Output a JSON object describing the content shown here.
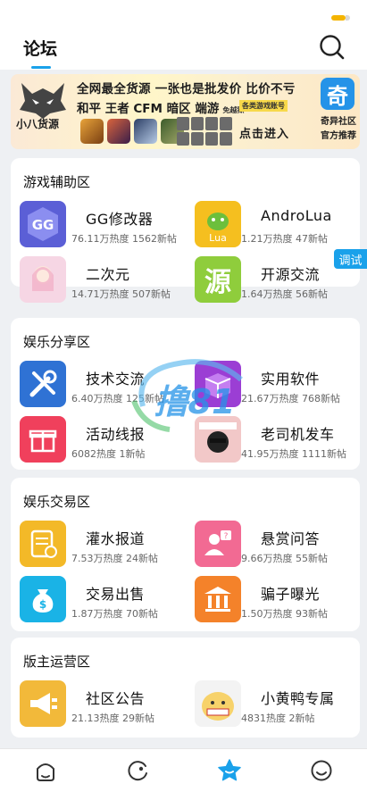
{
  "header": {
    "title": "论坛"
  },
  "banner": {
    "logo_text": "小八货源",
    "line1": "全网最全货源 一张也是批发价 比价不亏",
    "line2": "和平 王者 CFM 暗区 端游",
    "line2_sub": "免越狱",
    "tag": "各类游戏账号",
    "cta": "点击进入",
    "right_icon": "奇",
    "right_name": "奇异社区",
    "right_sub": "官方推荐"
  },
  "sections": [
    {
      "title": "游戏辅助区",
      "forums": [
        {
          "name": "GG修改器",
          "stats": "76.11万热度 1562新帖",
          "icon": "gg-icon",
          "color": "#5b5fd6"
        },
        {
          "name": "AndroLua",
          "stats": "1.21万热度 47新帖",
          "icon": "lua-icon",
          "color": "#f5bf1f"
        },
        {
          "name": "二次元",
          "stats": "14.71万热度 507新帖",
          "icon": "anime-icon",
          "color": "#f6d6e4"
        },
        {
          "name": "开源交流",
          "stats": "1.64万热度 56新帖",
          "icon": "source-icon",
          "color": "#8fcd3c"
        }
      ]
    },
    {
      "title": "娱乐分享区",
      "forums": [
        {
          "name": "技术交流",
          "stats": "6.40万热度 125新帖",
          "icon": "tools-icon",
          "color": "#2f72d4"
        },
        {
          "name": "实用软件",
          "stats": "21.67万热度 768新帖",
          "icon": "box-icon",
          "color": "#9b3ed4"
        },
        {
          "name": "活动线报",
          "stats": "6082热度 1新帖",
          "icon": "gift-icon",
          "color": "#f0405c"
        },
        {
          "name": "老司机发车",
          "stats": "41.95万热度 1111新帖",
          "icon": "driver-icon",
          "color": "#f2c8c8"
        }
      ]
    },
    {
      "title": "娱乐交易区",
      "forums": [
        {
          "name": "灌水报道",
          "stats": "7.53万热度 24新帖",
          "icon": "note-icon",
          "color": "#f3b928"
        },
        {
          "name": "悬赏问答",
          "stats": "9.66万热度 55新帖",
          "icon": "question-icon",
          "color": "#f26a93"
        },
        {
          "name": "交易出售",
          "stats": "1.87万热度 70新帖",
          "icon": "money-bag-icon",
          "color": "#1ab3e6"
        },
        {
          "name": "骗子曝光",
          "stats": "1.50万热度 93新帖",
          "icon": "bank-icon",
          "color": "#f4822a"
        }
      ]
    },
    {
      "title": "版主运营区",
      "forums": [
        {
          "name": "社区公告",
          "stats": "21.13热度 29新帖",
          "icon": "megaphone-icon",
          "color": "#f2b93a"
        },
        {
          "name": "小黄鸭专属",
          "stats": "4831热度 2新帖",
          "icon": "duck-icon",
          "color": "#f7d26a"
        }
      ]
    }
  ],
  "debug_tab": "调试",
  "watermark": "撸81",
  "tabbar": {
    "items": [
      {
        "icon": "home-icon"
      },
      {
        "icon": "discover-icon"
      },
      {
        "icon": "star-icon",
        "active": true
      },
      {
        "icon": "profile-icon"
      }
    ]
  },
  "colors": {
    "accent": "#1aa1ea",
    "background": "#eef0f3"
  }
}
